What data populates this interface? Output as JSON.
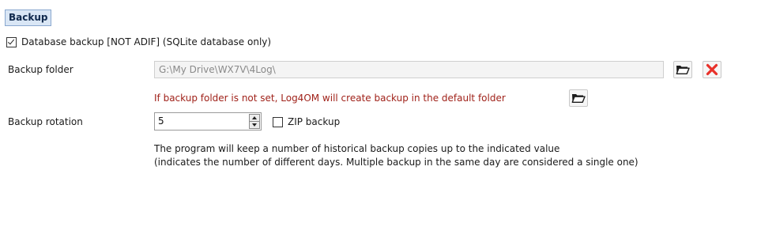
{
  "section": {
    "title": "Backup"
  },
  "database_backup": {
    "checked": true,
    "label": "Database backup [NOT ADIF] (SQLite database only)"
  },
  "backup_folder": {
    "label": "Backup folder",
    "value": "G:\\My Drive\\WX7V\\4Log\\",
    "browse_icon": "folder-open-icon",
    "clear_icon": "red-x-icon"
  },
  "warning": {
    "text": "If backup folder is not set, Log4OM will create backup in the default folder",
    "open_icon": "folder-open-icon"
  },
  "backup_rotation": {
    "label": "Backup rotation",
    "value": "5"
  },
  "zip_backup": {
    "checked": false,
    "label": "ZIP backup"
  },
  "info": {
    "line1": "The program will keep a number of historical backup copies up to the indicated value",
    "line2": "(indicates the number of different days. Multiple backup in the same day are considered a single one)"
  },
  "colors": {
    "header_bg": "#d9e6f5",
    "warning_text": "#a0221a",
    "clear_icon": "#e8312a"
  }
}
